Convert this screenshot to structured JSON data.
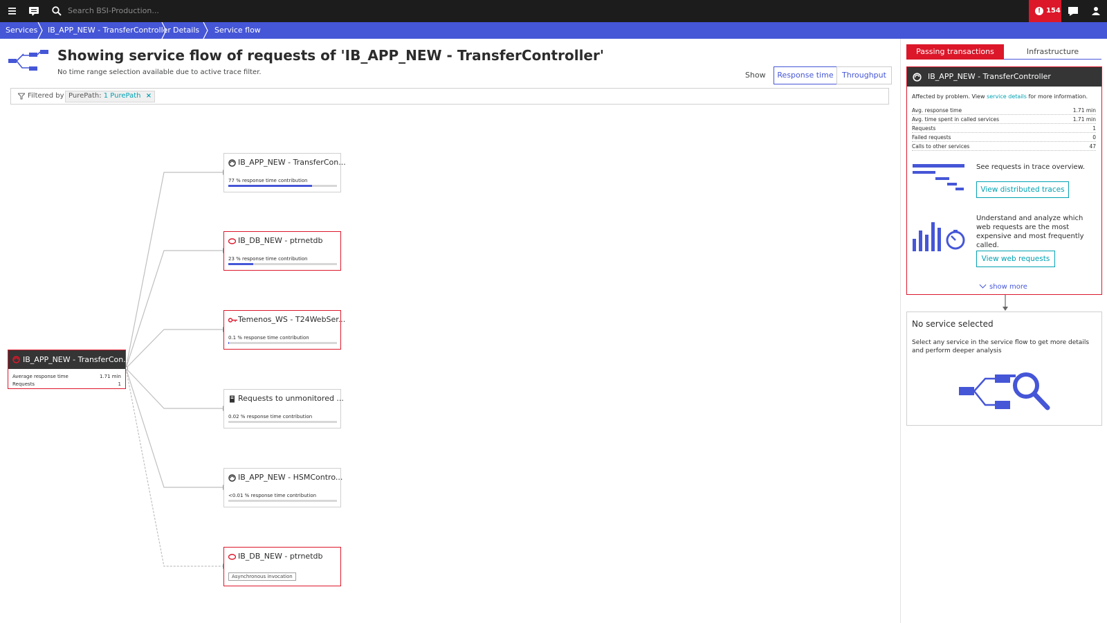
{
  "topbar": {
    "search_placeholder": "Search BSI-Production...",
    "alert_count": "154",
    "icons": [
      "menu-icon",
      "chat-icon",
      "search-icon",
      "alert-icon",
      "comment-icon",
      "user-icon"
    ]
  },
  "breadcrumb": [
    "Services",
    "IB_APP_NEW - TransferController",
    "Details",
    "Service flow"
  ],
  "header": {
    "title": "Showing service flow of requests of 'IB_APP_NEW - TransferController'",
    "subtitle": "No time range selection available due to active trace filter.",
    "show_label": "Show",
    "toggles": [
      {
        "label": "Response time",
        "active": true
      },
      {
        "label": "Throughput",
        "active": false
      }
    ]
  },
  "filter": {
    "label": "Filtered by",
    "chip_key": "PurePath:",
    "chip_value": "1 PurePath",
    "chip_close": "×"
  },
  "root_node": {
    "title": "IB_APP_NEW - TransferCon...",
    "rows": [
      {
        "label": "Average response time",
        "value": "1.71 min"
      },
      {
        "label": "Requests",
        "value": "1"
      }
    ]
  },
  "nodes": [
    {
      "title": "IB_APP_NEW - TransferCon...",
      "icon": "service-icon",
      "metric": "77 % response time contribution",
      "fraction": 0.77,
      "problem": false
    },
    {
      "title": "IB_DB_NEW - ptrnetdb",
      "icon": "database-icon",
      "metric": "23 % response time contribution",
      "fraction": 0.23,
      "problem": true
    },
    {
      "title": "Temenos_WS - T24WebSer...",
      "icon": "webservice-icon",
      "metric": "0.1 % response time contribution",
      "fraction": 0.001,
      "problem": true
    },
    {
      "title": "Requests to unmonitored ...",
      "icon": "unmonitored-icon",
      "metric": "0.02 % response time contribution",
      "fraction": 0.0002,
      "problem": false
    },
    {
      "title": "IB_APP_NEW - HSMContro...",
      "icon": "service-icon",
      "metric": "<0.01 % response time contribution",
      "fraction": 0.0001,
      "problem": false
    },
    {
      "title": "IB_DB_NEW - ptrnetdb",
      "icon": "database-icon",
      "metric": "Asynchronous invocation",
      "fraction": 0,
      "problem": true
    }
  ],
  "sidebar": {
    "tabs": [
      {
        "label": "Passing transactions",
        "active": true
      },
      {
        "label": "Infrastructure",
        "active": false
      }
    ],
    "service_card": {
      "title": "IB_APP_NEW - TransferController",
      "affected_prefix": "Affected by problem. View",
      "affected_link": "service details",
      "affected_suffix": "for more information.",
      "metrics": [
        {
          "label": "Avg. response time",
          "value": "1.71 min"
        },
        {
          "label": "Avg. time spent in called services",
          "value": "1.71 min"
        },
        {
          "label": "Requests",
          "value": "1"
        },
        {
          "label": "Failed requests",
          "value": "0"
        },
        {
          "label": "Calls to other services",
          "value": "47"
        }
      ],
      "trace_text": "See requests in trace overview.",
      "trace_button": "View distributed traces",
      "web_text": "Understand and analyze which web requests are the most expensive and most frequently called.",
      "web_button": "View web requests",
      "show_more": "show more"
    },
    "selection_card": {
      "title": "No service selected",
      "description": "Select any service in the service flow to get more details and perform deeper analysis"
    }
  },
  "colors": {
    "accent": "#4556d7",
    "problem": "#dc172a",
    "teal": "#00a1b2",
    "dark": "#353535"
  }
}
